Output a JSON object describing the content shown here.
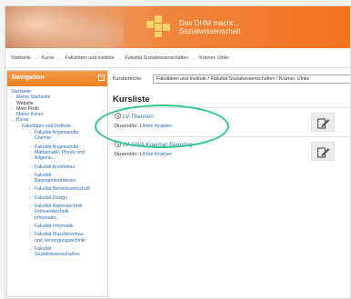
{
  "banner": {
    "line1": "Das OHM macht...",
    "line2": "Sozialwissenschaft"
  },
  "breadcrumb": [
    "Startseite",
    "Kurse",
    "Fakultäten und Institute",
    "Fakultät Sozialwissenschaften",
    "Krämer, Ulrike"
  ],
  "breadcrumb_sep": "→",
  "nav": {
    "title": "Navigation",
    "collapse": "−",
    "items": {
      "startseite": "Startseite",
      "meine_startseite": "Meine Startseite",
      "website": "Website",
      "mein_profil": "Mein Profil",
      "meine_kurse": "Meine Kurse",
      "kurse": "Kurse",
      "fakultaeten": "Fakultäten und Institute",
      "f1": [
        "Fakultät Angewandte",
        "Chemie"
      ],
      "f2": [
        "Fakultät Angewandte",
        "Mathematik, Physik und",
        "Allgeme..."
      ],
      "f3": [
        "Fakultät Architektur"
      ],
      "f4": [
        "Fakultät",
        "Bauingenieurwesen"
      ],
      "f5": [
        "Fakultät Betriebswirtschaft"
      ],
      "f6": [
        "Fakultät Design"
      ],
      "f7": [
        "Fakultät Elektrotechnik",
        "Feinwerktechnik",
        "Informatio..."
      ],
      "f8": [
        "Fakultät Informatik"
      ],
      "f9": [
        "Fakultät Maschinenbau",
        "und Versorgungstechnik"
      ],
      "f10": [
        "Fakultät",
        "Sozialwissenschaften"
      ]
    }
  },
  "main": {
    "kursbereiche_label": "Kursbereiche:",
    "kursbereiche_value": "Fakultäten und Institute / Fakultät Sozialwissenschaften / Krämer, Ulrike",
    "kursliste_title": "Kursliste",
    "courses": [
      {
        "title": "LV-Theorien",
        "dozent_label": "Dozent/in:",
        "dozent_name": "Ulrike Krämer"
      },
      {
        "title": "LV-GWA Kraemer-Dienstag",
        "dozent_label": "Dozent/in:",
        "dozent_name": "Ulrike Krämer"
      }
    ]
  },
  "colors": {
    "accent_orange": "#ef7f1f",
    "link_blue": "#2a6db4",
    "highlight_green": "#2ec98a"
  }
}
